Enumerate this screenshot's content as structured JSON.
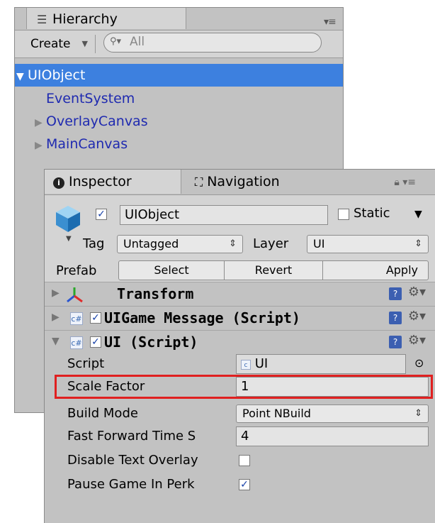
{
  "hierarchy": {
    "tab_label": "Hierarchy",
    "create_label": "Create",
    "search_placeholder": "All",
    "items": [
      {
        "label": "UIObject"
      },
      {
        "label": "EventSystem"
      },
      {
        "label": "OverlayCanvas"
      },
      {
        "label": "MainCanvas"
      }
    ]
  },
  "inspector": {
    "tabs": [
      {
        "label": "Inspector"
      },
      {
        "label": "Navigation"
      }
    ],
    "object_name": "UIObject",
    "static_label": "Static",
    "tag_label": "Tag",
    "tag_value": "Untagged",
    "layer_label": "Layer",
    "layer_value": "UI",
    "prefab_label": "Prefab",
    "prefab_buttons": [
      "Select",
      "Revert",
      "Apply"
    ],
    "components": [
      {
        "title": "Transform"
      },
      {
        "title": "UIGame Message (Script)"
      },
      {
        "title": "UI (Script)"
      }
    ],
    "properties": [
      {
        "label": "Script",
        "value": "UI"
      },
      {
        "label": "Scale Factor",
        "value": "1"
      },
      {
        "label": "Build Mode",
        "value": "Point NBuild"
      },
      {
        "label": "Fast Forward Time S",
        "value": "4"
      },
      {
        "label": "Disable Text Overlay",
        "value": ""
      },
      {
        "label": "Pause Game In Perk",
        "value": ""
      }
    ]
  },
  "colors": {
    "selection": "#3d80df",
    "highlight": "#e02020",
    "link_blue": "#1f2ab0"
  }
}
